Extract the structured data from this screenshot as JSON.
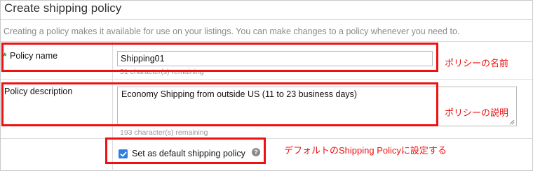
{
  "header": {
    "title": "Create shipping policy"
  },
  "intro_text": "Creating a policy makes it available for use on your listings. You can make changes to a policy whenever you need to.",
  "policy_name": {
    "label": "Policy name",
    "required_mark": "*",
    "value": "Shipping01",
    "remaining": "51 character(s) remaining"
  },
  "policy_description": {
    "label": "Policy description",
    "value": "Economy Shipping from outside US (11 to 23 business days)",
    "remaining": "193 character(s) remaining"
  },
  "default_option": {
    "label": "Set as default shipping policy",
    "checked": true,
    "help_glyph": "?"
  },
  "annotations": {
    "name": "ポリシーの名前",
    "description": "ポリシーの説明",
    "default": "デフォルトのShipping Policyに設定する",
    "color": "#ee1111"
  },
  "colors": {
    "accent": "#2f7de1",
    "required": "#2e9e2e"
  }
}
